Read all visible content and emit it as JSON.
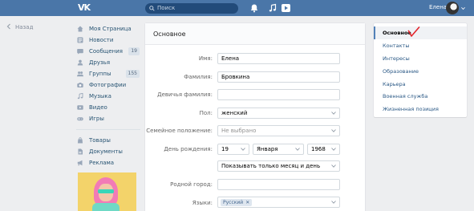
{
  "header": {
    "logo": "VK",
    "search_placeholder": "Поиск",
    "user_name": "Елена"
  },
  "back_label": "Назад",
  "menu": {
    "items": [
      {
        "label": "Моя Страница",
        "icon": "home-icon"
      },
      {
        "label": "Новости",
        "icon": "news-icon"
      },
      {
        "label": "Сообщения",
        "icon": "message-icon",
        "count": "19"
      },
      {
        "label": "Друзья",
        "icon": "friend-icon"
      },
      {
        "label": "Группы",
        "icon": "group-icon",
        "count": "155"
      },
      {
        "label": "Фотографии",
        "icon": "camera-icon"
      },
      {
        "label": "Музыка",
        "icon": "music-icon"
      },
      {
        "label": "Видео",
        "icon": "video-icon"
      },
      {
        "label": "Игры",
        "icon": "game-icon"
      }
    ],
    "items2": [
      {
        "label": "Товары",
        "icon": "shop-icon"
      },
      {
        "label": "Документы",
        "icon": "document-icon"
      },
      {
        "label": "Реклама",
        "icon": "megaphone-icon"
      }
    ]
  },
  "form": {
    "title": "Основное",
    "first_name_label": "Имя:",
    "first_name_value": "Елена",
    "last_name_label": "Фамилия:",
    "last_name_value": "Бровкина",
    "maiden_label": "Девичья фамилия:",
    "maiden_value": "",
    "gender_label": "Пол:",
    "gender_value": "женский",
    "marital_label": "Семейное положение:",
    "marital_value": "Не выбрано",
    "birthday_label": "День рождения:",
    "birth_day": "19",
    "birth_month": "Января",
    "birth_year": "1968",
    "birthday_visibility": "Показывать только месяц и день",
    "hometown_label": "Родной город:",
    "hometown_value": "",
    "languages_label": "Языки:",
    "language_chip": "Русский"
  },
  "right_nav": {
    "items": [
      "Основное",
      "Контакты",
      "Интересы",
      "Образование",
      "Карьера",
      "Военная служба",
      "Жизненная позиция"
    ]
  },
  "colors": {
    "header": "#4a76a8",
    "accent": "#5181b8",
    "checkmark": "#e3242b"
  }
}
